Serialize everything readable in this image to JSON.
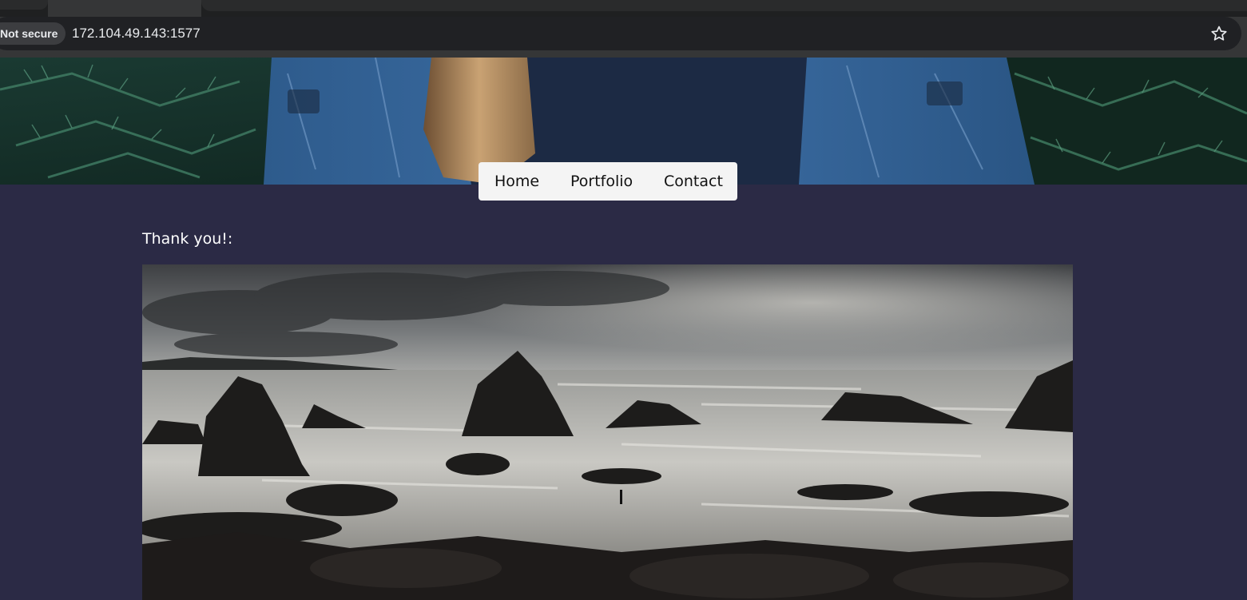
{
  "browser": {
    "security_chip": "Not secure",
    "url": "172.104.49.143:1577",
    "star_icon": "star-outline-icon"
  },
  "nav": {
    "items": [
      "Home",
      "Portfolio",
      "Contact"
    ]
  },
  "main": {
    "message": "Thank you!:"
  },
  "colors": {
    "page_background": "#2b2a45",
    "nav_background": "#f4f4f4",
    "message_text": "#ffffff"
  }
}
